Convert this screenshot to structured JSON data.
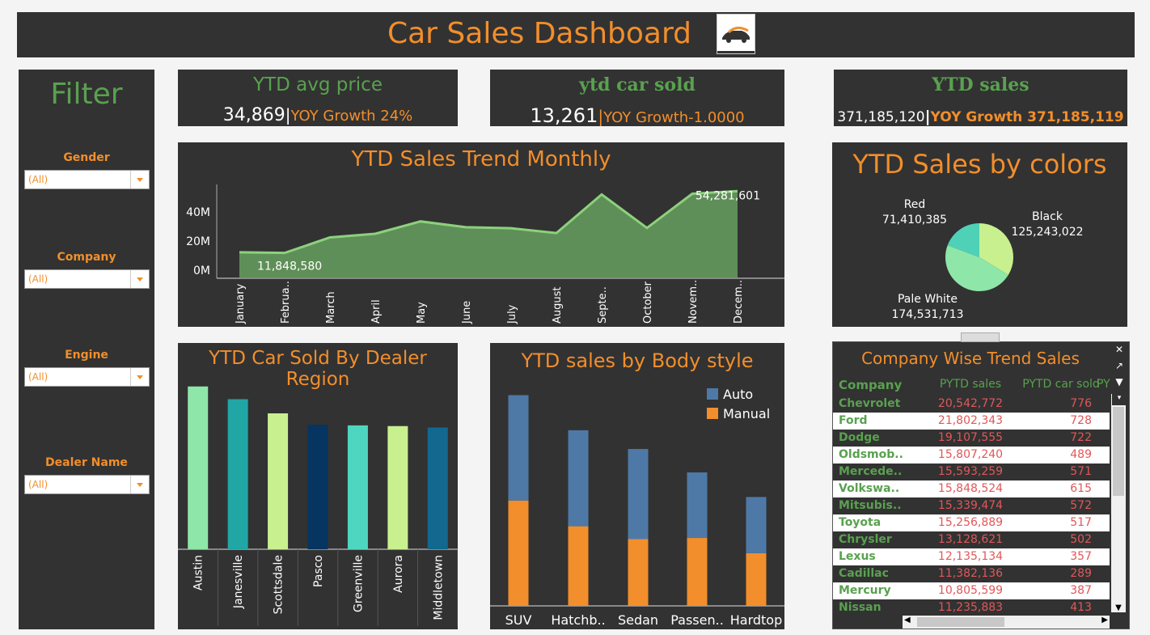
{
  "header": {
    "title": "Car Sales Dashboard"
  },
  "filter": {
    "title": "Filter",
    "fields": [
      {
        "label": "Gender",
        "value": "(All)"
      },
      {
        "label": "Company",
        "value": "(All)"
      },
      {
        "label": "Engine",
        "value": "(All)"
      },
      {
        "label": "Dealer Name",
        "value": "(All)"
      }
    ]
  },
  "kpis": {
    "avg_price": {
      "title": "YTD avg price",
      "value": "34,869",
      "sep": "|",
      "growth": "YOY Growth 24%"
    },
    "car_sold": {
      "title": "ytd car sold",
      "value": "13,261",
      "sep": "|",
      "growth": "YOY Growth-1.0000"
    },
    "sales": {
      "title": "YTD sales",
      "value": "371,185,120",
      "sep": "|",
      "growth": "YOY Growth 371,185,119"
    }
  },
  "trend": {
    "title": "YTD Sales Trend Monthly",
    "min_label": "11,848,580",
    "max_label": "54,281,601"
  },
  "colors_chart": {
    "title": "YTD Sales by colors",
    "labels": [
      {
        "name": "Red",
        "value": "71,410,385"
      },
      {
        "name": "Black",
        "value": "125,243,022"
      },
      {
        "name": "Pale White",
        "value": "174,531,713"
      }
    ]
  },
  "region": {
    "title": "YTD Car Sold By Dealer Region"
  },
  "body_style": {
    "title": "YTD sales by Body style"
  },
  "table": {
    "title": "Company Wise Trend Sales",
    "headers": [
      "Company",
      "PYTD sales",
      "PYTD car sold",
      "PY"
    ],
    "rows": [
      {
        "company": "Chevrolet",
        "sales": "20,542,772",
        "sold": "776"
      },
      {
        "company": "Ford",
        "sales": "21,802,343",
        "sold": "728"
      },
      {
        "company": "Dodge",
        "sales": "19,107,555",
        "sold": "722"
      },
      {
        "company": "Oldsmob..",
        "sales": "15,807,240",
        "sold": "489"
      },
      {
        "company": "Mercede..",
        "sales": "15,593,259",
        "sold": "571"
      },
      {
        "company": "Volkswa..",
        "sales": "15,848,524",
        "sold": "615"
      },
      {
        "company": "Mitsubis..",
        "sales": "15,339,474",
        "sold": "572"
      },
      {
        "company": "Toyota",
        "sales": "15,256,889",
        "sold": "517"
      },
      {
        "company": "Chrysler",
        "sales": "13,128,621",
        "sold": "502"
      },
      {
        "company": "Lexus",
        "sales": "12,135,134",
        "sold": "357"
      },
      {
        "company": "Cadillac",
        "sales": "11,382,136",
        "sold": "289"
      },
      {
        "company": "Mercury",
        "sales": "10,805,599",
        "sold": "387"
      },
      {
        "company": "Nissan",
        "sales": "11,235,883",
        "sold": "413"
      }
    ]
  },
  "colors": {
    "accent": "#f28e2b",
    "green": "#59a14f",
    "panel": "#323232"
  },
  "chart_data": [
    {
      "type": "area",
      "title": "YTD Sales Trend Monthly",
      "categories": [
        "January",
        "Februa..",
        "March",
        "April",
        "May",
        "June",
        "July",
        "August",
        "Septe..",
        "October",
        "Novem..",
        "Decem.."
      ],
      "values": [
        12300000,
        11848580,
        22500000,
        25000000,
        33500000,
        29500000,
        28800000,
        25500000,
        52000000,
        29000000,
        52500000,
        54281601
      ],
      "yticks": [
        "0M",
        "20M",
        "40M"
      ],
      "ylim": [
        -5000000,
        60000000
      ]
    },
    {
      "type": "pie",
      "title": "YTD Sales by colors",
      "categories": [
        "Black",
        "Pale White",
        "Red"
      ],
      "values": [
        125243022,
        174531713,
        71410385
      ],
      "colors": [
        "#c8f08f",
        "#8ee6a8",
        "#4fd1b8"
      ]
    },
    {
      "type": "bar",
      "title": "YTD Car Sold By Dealer Region",
      "categories": [
        "Austin",
        "Janesville",
        "Scottsdale",
        "Pasco",
        "Greenville",
        "Aurora",
        "Middletown"
      ],
      "values": [
        2300,
        2120,
        1920,
        1760,
        1750,
        1740,
        1720
      ],
      "colors": [
        "#8ee6a8",
        "#21a6a6",
        "#c8f08f",
        "#053560",
        "#4fd6c0",
        "#c8f08f",
        "#12688f"
      ],
      "ylim": [
        0,
        2400
      ]
    },
    {
      "type": "bar",
      "title": "YTD sales by Body style",
      "categories": [
        "SUV",
        "Hatchb..",
        "Sedan",
        "Passen..",
        "Hardtop"
      ],
      "series": [
        {
          "name": "Manual",
          "values": [
            45,
            34,
            28.5,
            29,
            22.5
          ],
          "color": "#f28e2b"
        },
        {
          "name": "Auto",
          "values": [
            45,
            41,
            38.5,
            28,
            24
          ],
          "color": "#4e79a7"
        }
      ],
      "stacked": true,
      "ylim": [
        0,
        95
      ]
    }
  ]
}
